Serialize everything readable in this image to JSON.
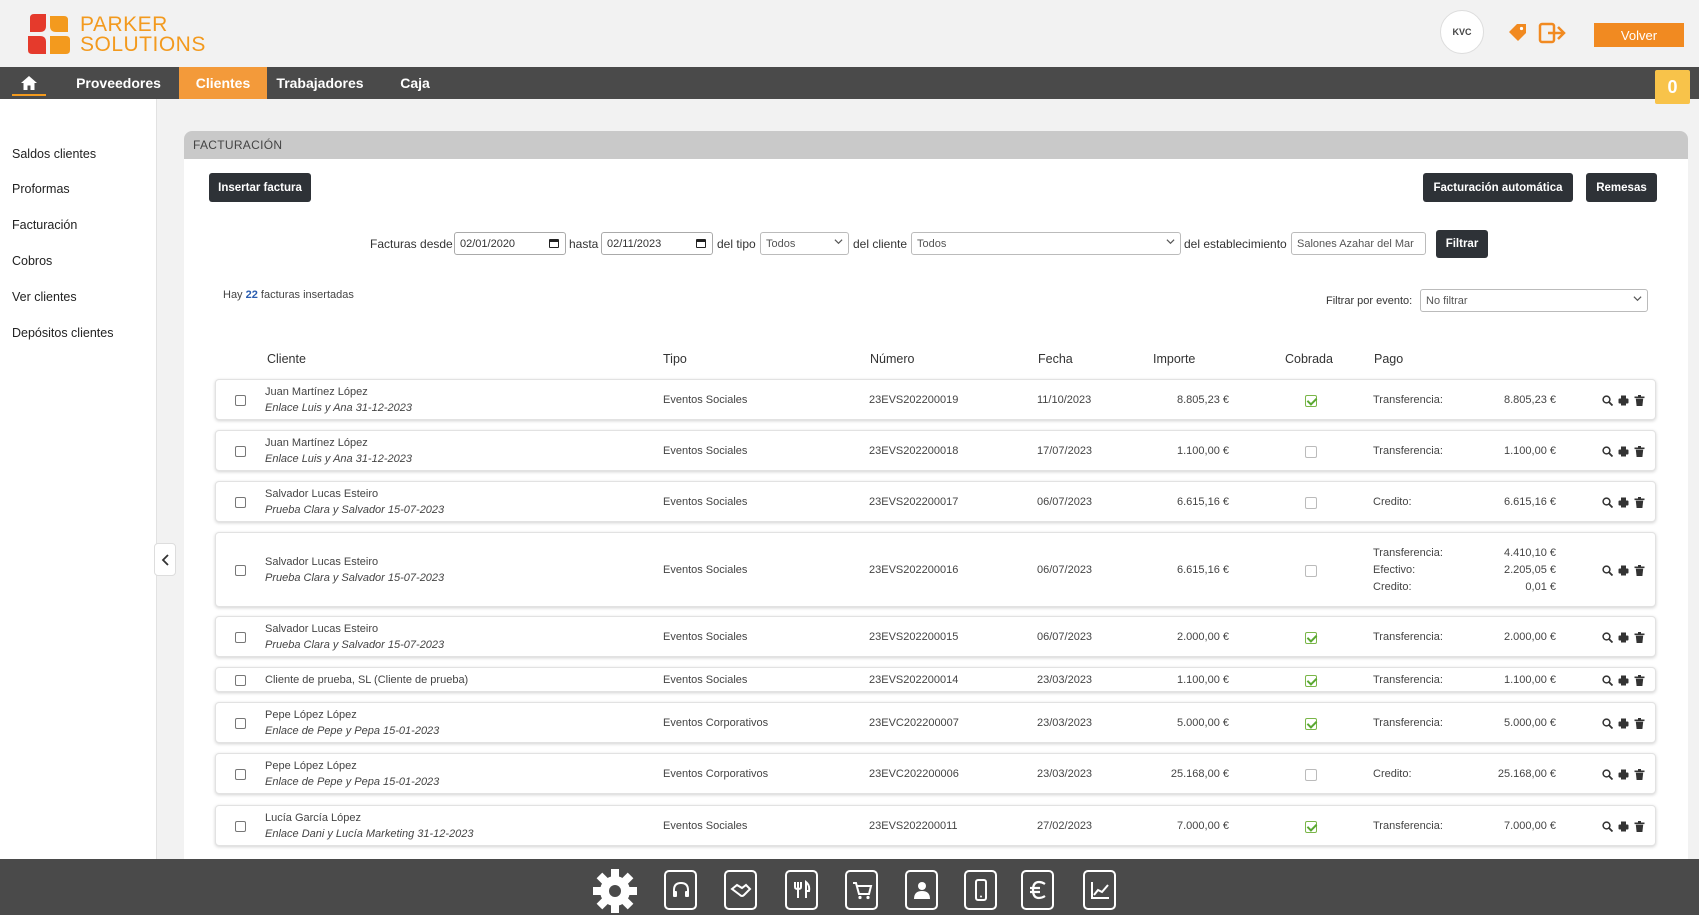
{
  "brand": {
    "line1": "PARKER",
    "line2": "SOLUTIONS",
    "colors": {
      "orange": "#f39a1e",
      "red": "#e53a2c",
      "nav": "#4a4a4a",
      "active": "#f39a3a"
    }
  },
  "header": {
    "avatar_text": "KVC",
    "volver": "Volver",
    "icons": [
      "notification-tag-icon",
      "logout-icon"
    ]
  },
  "nav": {
    "items": [
      "Proveedores",
      "Clientes",
      "Trabajadores",
      "Caja"
    ],
    "active": "Clientes",
    "cart_count": "0"
  },
  "sidebar": {
    "items": [
      "Saldos clientes",
      "Proformas",
      "Facturación",
      "Cobros",
      "Ver clientes",
      "Depósitos clientes"
    ]
  },
  "panel": {
    "title": "FACTURACIÓN",
    "insert": "Insertar factura",
    "auto": "Facturación automática",
    "remesas": "Remesas"
  },
  "filters": {
    "desde_label": "Facturas desde",
    "desde": "02/01/2020",
    "hasta_label": "hasta",
    "hasta": "02/11/2023",
    "tipo_label": "del tipo",
    "tipo": "Todos",
    "cliente_label": "del cliente",
    "cliente": "Todos",
    "est_label": "del establecimiento",
    "establecimiento": "Salones Azahar del Mar",
    "filtrar": "Filtrar",
    "evento_label": "Filtrar por evento:",
    "evento": "No filtrar"
  },
  "count": {
    "pre": "Hay ",
    "n": "22",
    "post": " facturas insertadas"
  },
  "table": {
    "headers": [
      "Cliente",
      "Tipo",
      "Número",
      "Fecha",
      "Importe",
      "Cobrada",
      "Pago"
    ],
    "rows": [
      {
        "cliente": "Juan Martínez López",
        "evento": "Enlace Luis y Ana 31-12-2023",
        "tipo": "Eventos Sociales",
        "numero": "23EVS202200019",
        "fecha": "11/10/2023",
        "importe": "8.805,23 €",
        "cobrada": true,
        "pago": [
          [
            "Transferencia:",
            "8.805,23 €"
          ]
        ]
      },
      {
        "cliente": "Juan Martínez López",
        "evento": "Enlace Luis y Ana 31-12-2023",
        "tipo": "Eventos Sociales",
        "numero": "23EVS202200018",
        "fecha": "17/07/2023",
        "importe": "1.100,00 €",
        "cobrada": false,
        "pago": [
          [
            "Transferencia:",
            "1.100,00 €"
          ]
        ]
      },
      {
        "cliente": "Salvador Lucas Esteiro",
        "evento": "Prueba Clara y Salvador 15-07-2023",
        "tipo": "Eventos Sociales",
        "numero": "23EVS202200017",
        "fecha": "06/07/2023",
        "importe": "6.615,16 €",
        "cobrada": false,
        "pago": [
          [
            "Credito:",
            "6.615,16 €"
          ]
        ]
      },
      {
        "cliente": "Salvador Lucas Esteiro",
        "evento": "Prueba Clara y Salvador 15-07-2023",
        "tipo": "Eventos Sociales",
        "numero": "23EVS202200016",
        "fecha": "06/07/2023",
        "importe": "6.615,16 €",
        "cobrada": false,
        "pago": [
          [
            "Transferencia:",
            "4.410,10 €"
          ],
          [
            "Efectivo:",
            "2.205,05 €"
          ],
          [
            "Credito:",
            "0,01 €"
          ]
        ]
      },
      {
        "cliente": "Salvador Lucas Esteiro",
        "evento": "Prueba Clara y Salvador 15-07-2023",
        "tipo": "Eventos Sociales",
        "numero": "23EVS202200015",
        "fecha": "06/07/2023",
        "importe": "2.000,00 €",
        "cobrada": true,
        "pago": [
          [
            "Transferencia:",
            "2.000,00 €"
          ]
        ]
      },
      {
        "cliente": "Cliente de prueba, SL (Cliente de prueba)",
        "evento": "",
        "tipo": "Eventos Sociales",
        "numero": "23EVS202200014",
        "fecha": "23/03/2023",
        "importe": "1.100,00 €",
        "cobrada": true,
        "pago": [
          [
            "Transferencia:",
            "1.100,00 €"
          ]
        ]
      },
      {
        "cliente": "Pepe López López",
        "evento": "Enlace de Pepe y Pepa 15-01-2023",
        "tipo": "Eventos Corporativos",
        "numero": "23EVC202200007",
        "fecha": "23/03/2023",
        "importe": "5.000,00 €",
        "cobrada": true,
        "pago": [
          [
            "Transferencia:",
            "5.000,00 €"
          ]
        ]
      },
      {
        "cliente": "Pepe López López",
        "evento": "Enlace de Pepe y Pepa 15-01-2023",
        "tipo": "Eventos Corporativos",
        "numero": "23EVC202200006",
        "fecha": "23/03/2023",
        "importe": "25.168,00 €",
        "cobrada": false,
        "pago": [
          [
            "Credito:",
            "25.168,00 €"
          ]
        ]
      },
      {
        "cliente": "Lucía García López",
        "evento": "Enlace Dani y Lucía Marketing 31-12-2023",
        "tipo": "Eventos Sociales",
        "numero": "23EVS202200011",
        "fecha": "27/02/2023",
        "importe": "7.000,00 €",
        "cobrada": true,
        "pago": [
          [
            "Transferencia:",
            "7.000,00 €"
          ]
        ]
      }
    ]
  },
  "footer": {
    "icons": [
      "settings-gear-icon",
      "headset-icon",
      "handshake-icon",
      "restaurant-icon",
      "cart-icon",
      "contacts-icon",
      "mobile-icon",
      "euro-icon",
      "chart-icon"
    ]
  }
}
